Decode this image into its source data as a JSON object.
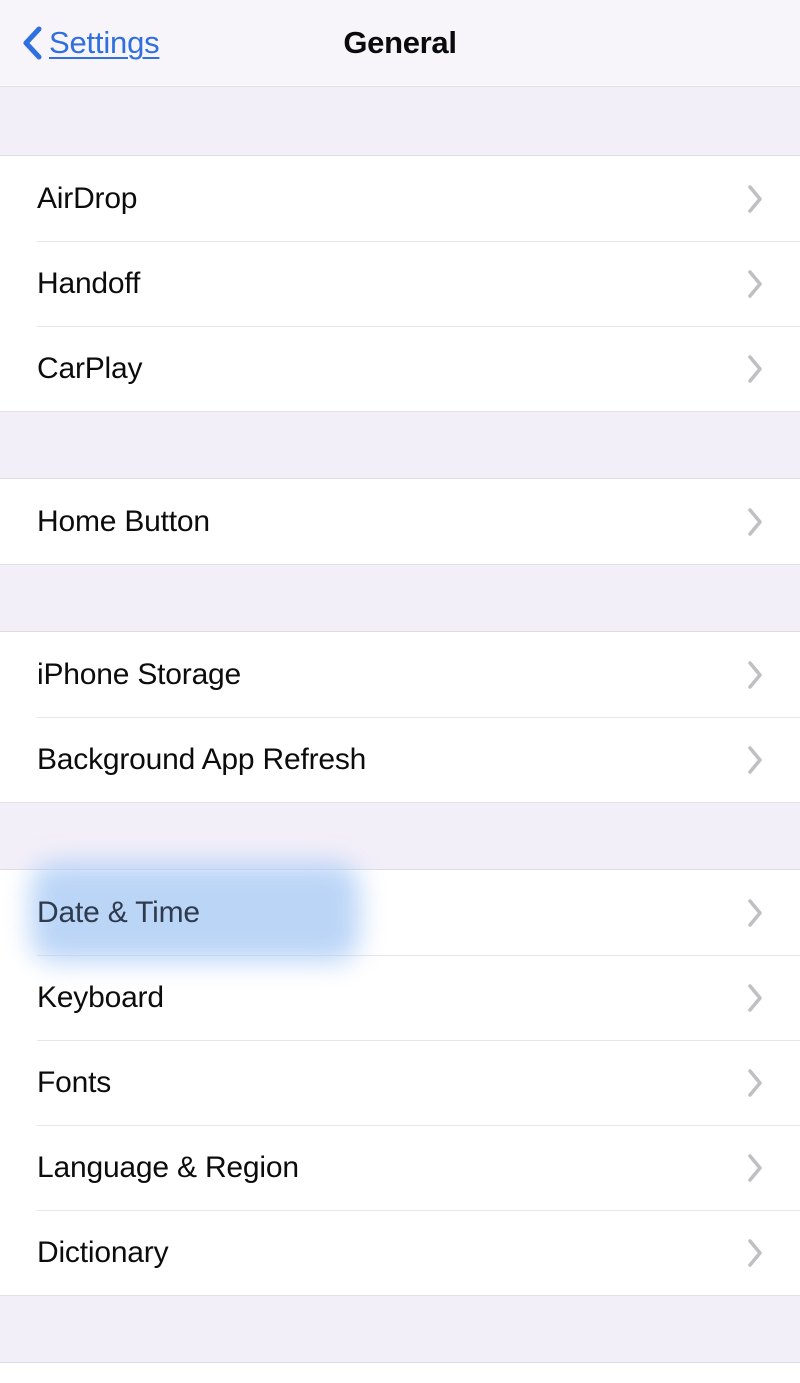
{
  "nav": {
    "back_label": "Settings",
    "back_icon": "chevron-left-icon",
    "title": "General",
    "accent_color": "#2f6fe0",
    "bar_background": "#f7f5f9"
  },
  "colors": {
    "group_gap_background": "#f3eff8",
    "row_background": "#ffffff",
    "separator": "#e6e5e9",
    "label_text": "#0c0c0d",
    "chevron": "#c0c0c4",
    "highlight_blue": "#a9caf6",
    "highlighted_label_text": "#2e3a4d"
  },
  "list": {
    "disclosure_icon": "chevron-right-icon",
    "groups": [
      {
        "id": "group-connectivity",
        "rows": [
          {
            "label": "AirDrop",
            "highlighted": false
          },
          {
            "label": "Handoff",
            "highlighted": false
          },
          {
            "label": "CarPlay",
            "highlighted": false
          }
        ]
      },
      {
        "id": "group-home-button",
        "rows": [
          {
            "label": "Home Button",
            "highlighted": false
          }
        ]
      },
      {
        "id": "group-storage",
        "rows": [
          {
            "label": "iPhone Storage",
            "highlighted": false
          },
          {
            "label": "Background App Refresh",
            "highlighted": false
          }
        ]
      },
      {
        "id": "group-localization",
        "rows": [
          {
            "label": "Date & Time",
            "highlighted": true
          },
          {
            "label": "Keyboard",
            "highlighted": false
          },
          {
            "label": "Fonts",
            "highlighted": false
          },
          {
            "label": "Language & Region",
            "highlighted": false
          },
          {
            "label": "Dictionary",
            "highlighted": false
          }
        ]
      }
    ]
  }
}
